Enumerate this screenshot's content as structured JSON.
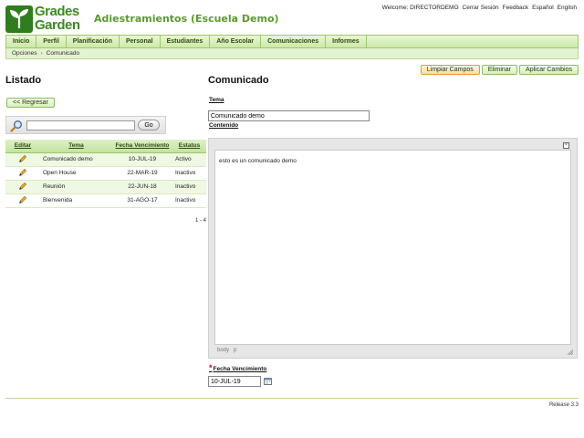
{
  "brand": {
    "logo_text": "Grades\nGarden",
    "app_title": "Adiestramientos (Escuela Demo)",
    "accent": "#5a9a30",
    "logo_color": "#2f7d1e"
  },
  "top_links": {
    "welcome": "Welcome: DIRECTORDEMO",
    "logout": "Cerrar Sesión",
    "feedback": "Feedback",
    "spanish": "Español",
    "english": "English"
  },
  "nav": [
    "Inicio",
    "Perfil",
    "Planificación",
    "Personal",
    "Estudiantes",
    "Año Escolar",
    "Comunicaciones",
    "Informes"
  ],
  "breadcrumb": {
    "parent": "Opciones",
    "separator": "›",
    "current": "Comunicado"
  },
  "actions": {
    "clear": "Limpiar Campos",
    "delete": "Eliminar",
    "apply": "Aplicar Cambios"
  },
  "left": {
    "title": "Listado",
    "back": "<< Regresar",
    "search": {
      "value": "",
      "go": "Go"
    },
    "columns": [
      "Editar",
      "Tema",
      "Fecha Vencimiento",
      "Estatus"
    ],
    "rows": [
      {
        "tema": "Comunicado demo",
        "fecha": "10-JUL-19",
        "estatus": "Activo"
      },
      {
        "tema": "Open House",
        "fecha": "22-MAR-19",
        "estatus": "Inactivo"
      },
      {
        "tema": "Reunión",
        "fecha": "22-JUN-18",
        "estatus": "Inactivo"
      },
      {
        "tema": "Bienvenida",
        "fecha": "31-AGO-17",
        "estatus": "Inactivo"
      }
    ],
    "pager": "1 - 4"
  },
  "right": {
    "title": "Comunicado",
    "tema_label": "Tema",
    "tema_value": "Comunicado demo",
    "contenido_label": "Contenido",
    "contenido_text": "esto es un comunicado demo",
    "editor_path": [
      "body",
      "p"
    ],
    "editor_close": "×",
    "required_mark": "*",
    "venc_label": "Fecha Vencimiento",
    "venc_value": "10-JUL-19"
  },
  "footer": {
    "release": "Release 3.3"
  }
}
